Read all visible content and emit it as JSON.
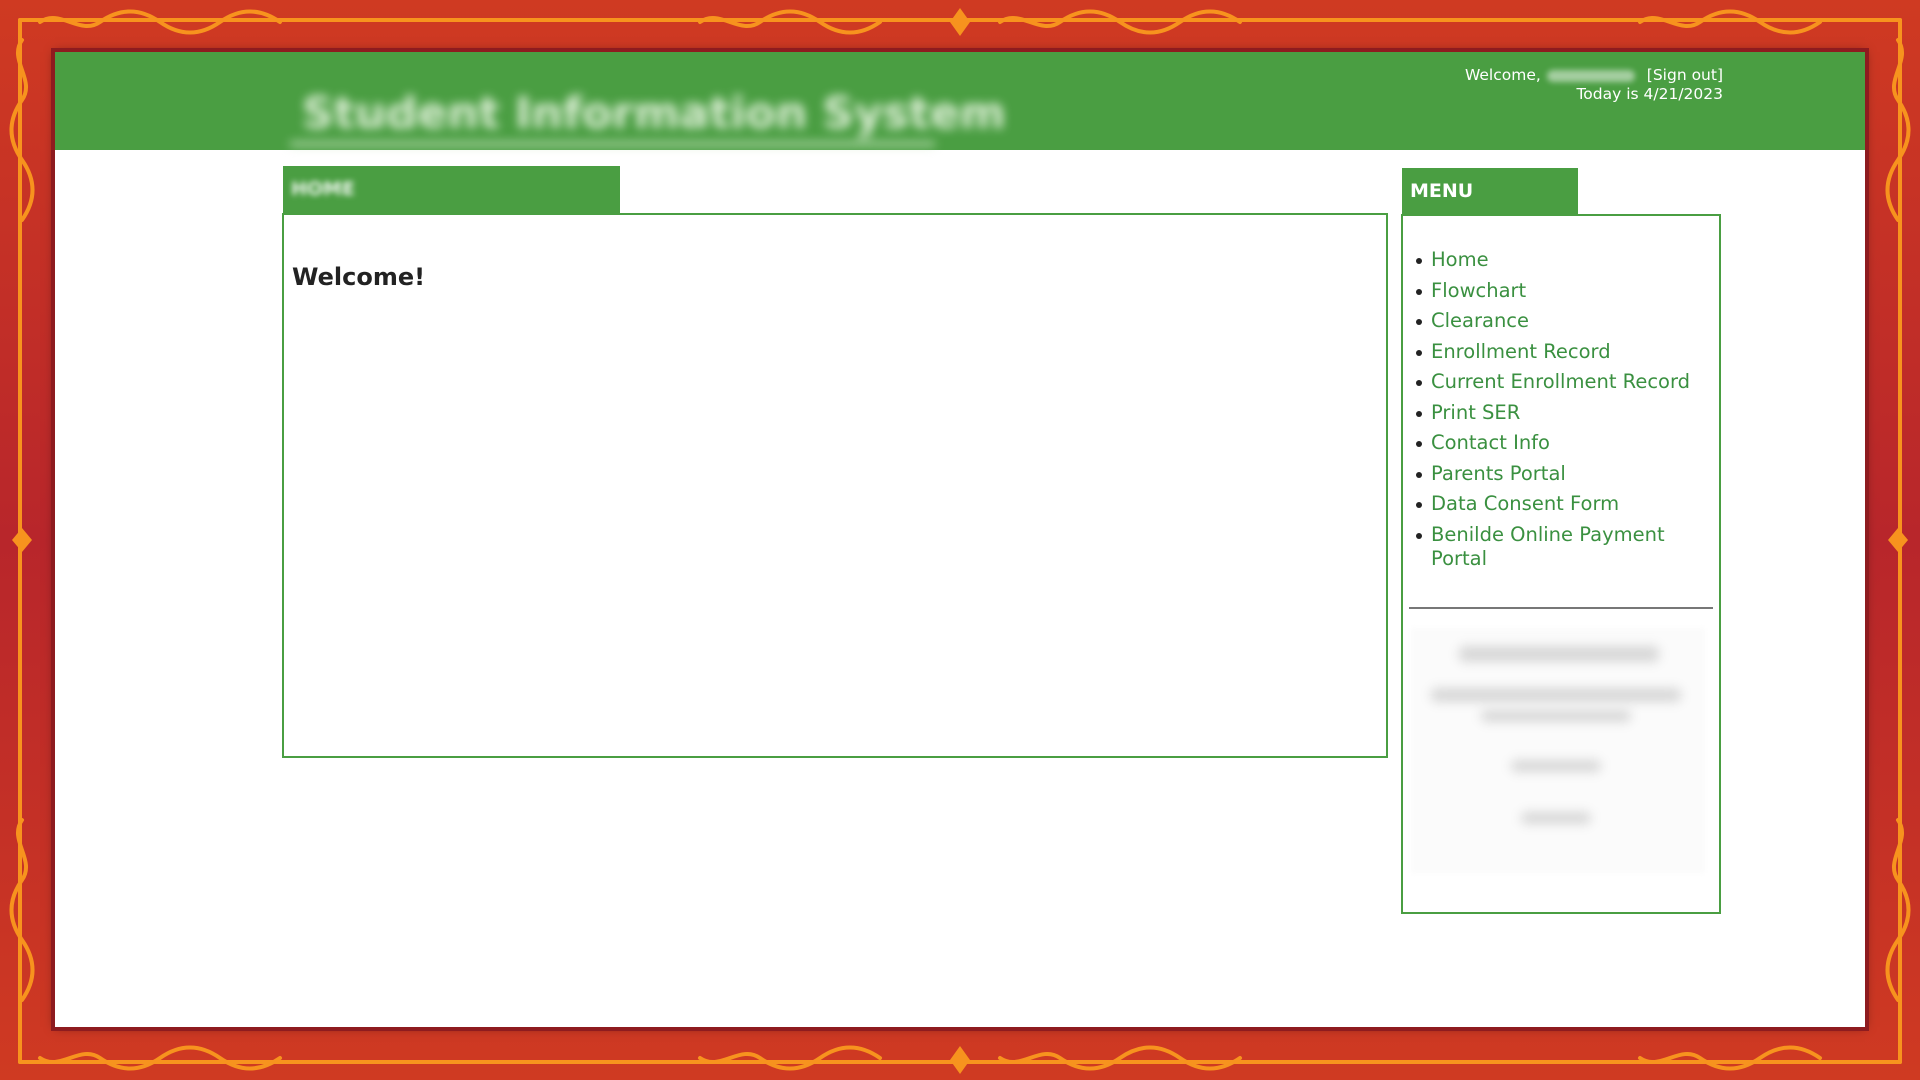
{
  "header": {
    "system_title": "Student Information System",
    "welcome_label": "Welcome,",
    "signout_label": "[Sign out]",
    "date_text": "Today is 4/21/2023"
  },
  "home_tab": {
    "label": "HOME"
  },
  "content": {
    "heading": "Welcome!"
  },
  "menu": {
    "title": "MENU",
    "items": [
      {
        "label": "Home"
      },
      {
        "label": "Flowchart"
      },
      {
        "label": "Clearance"
      },
      {
        "label": "Enrollment Record"
      },
      {
        "label": "Current Enrollment Record"
      },
      {
        "label": "Print SER"
      },
      {
        "label": "Contact Info"
      },
      {
        "label": "Parents Portal"
      },
      {
        "label": "Data Consent Form"
      },
      {
        "label": "Benilde Online Payment Portal"
      }
    ]
  },
  "colors": {
    "header_green": "#4a9e42",
    "link_green": "#3a9040",
    "frame_red": "#c1272d",
    "frame_orange": "#f7931e"
  }
}
